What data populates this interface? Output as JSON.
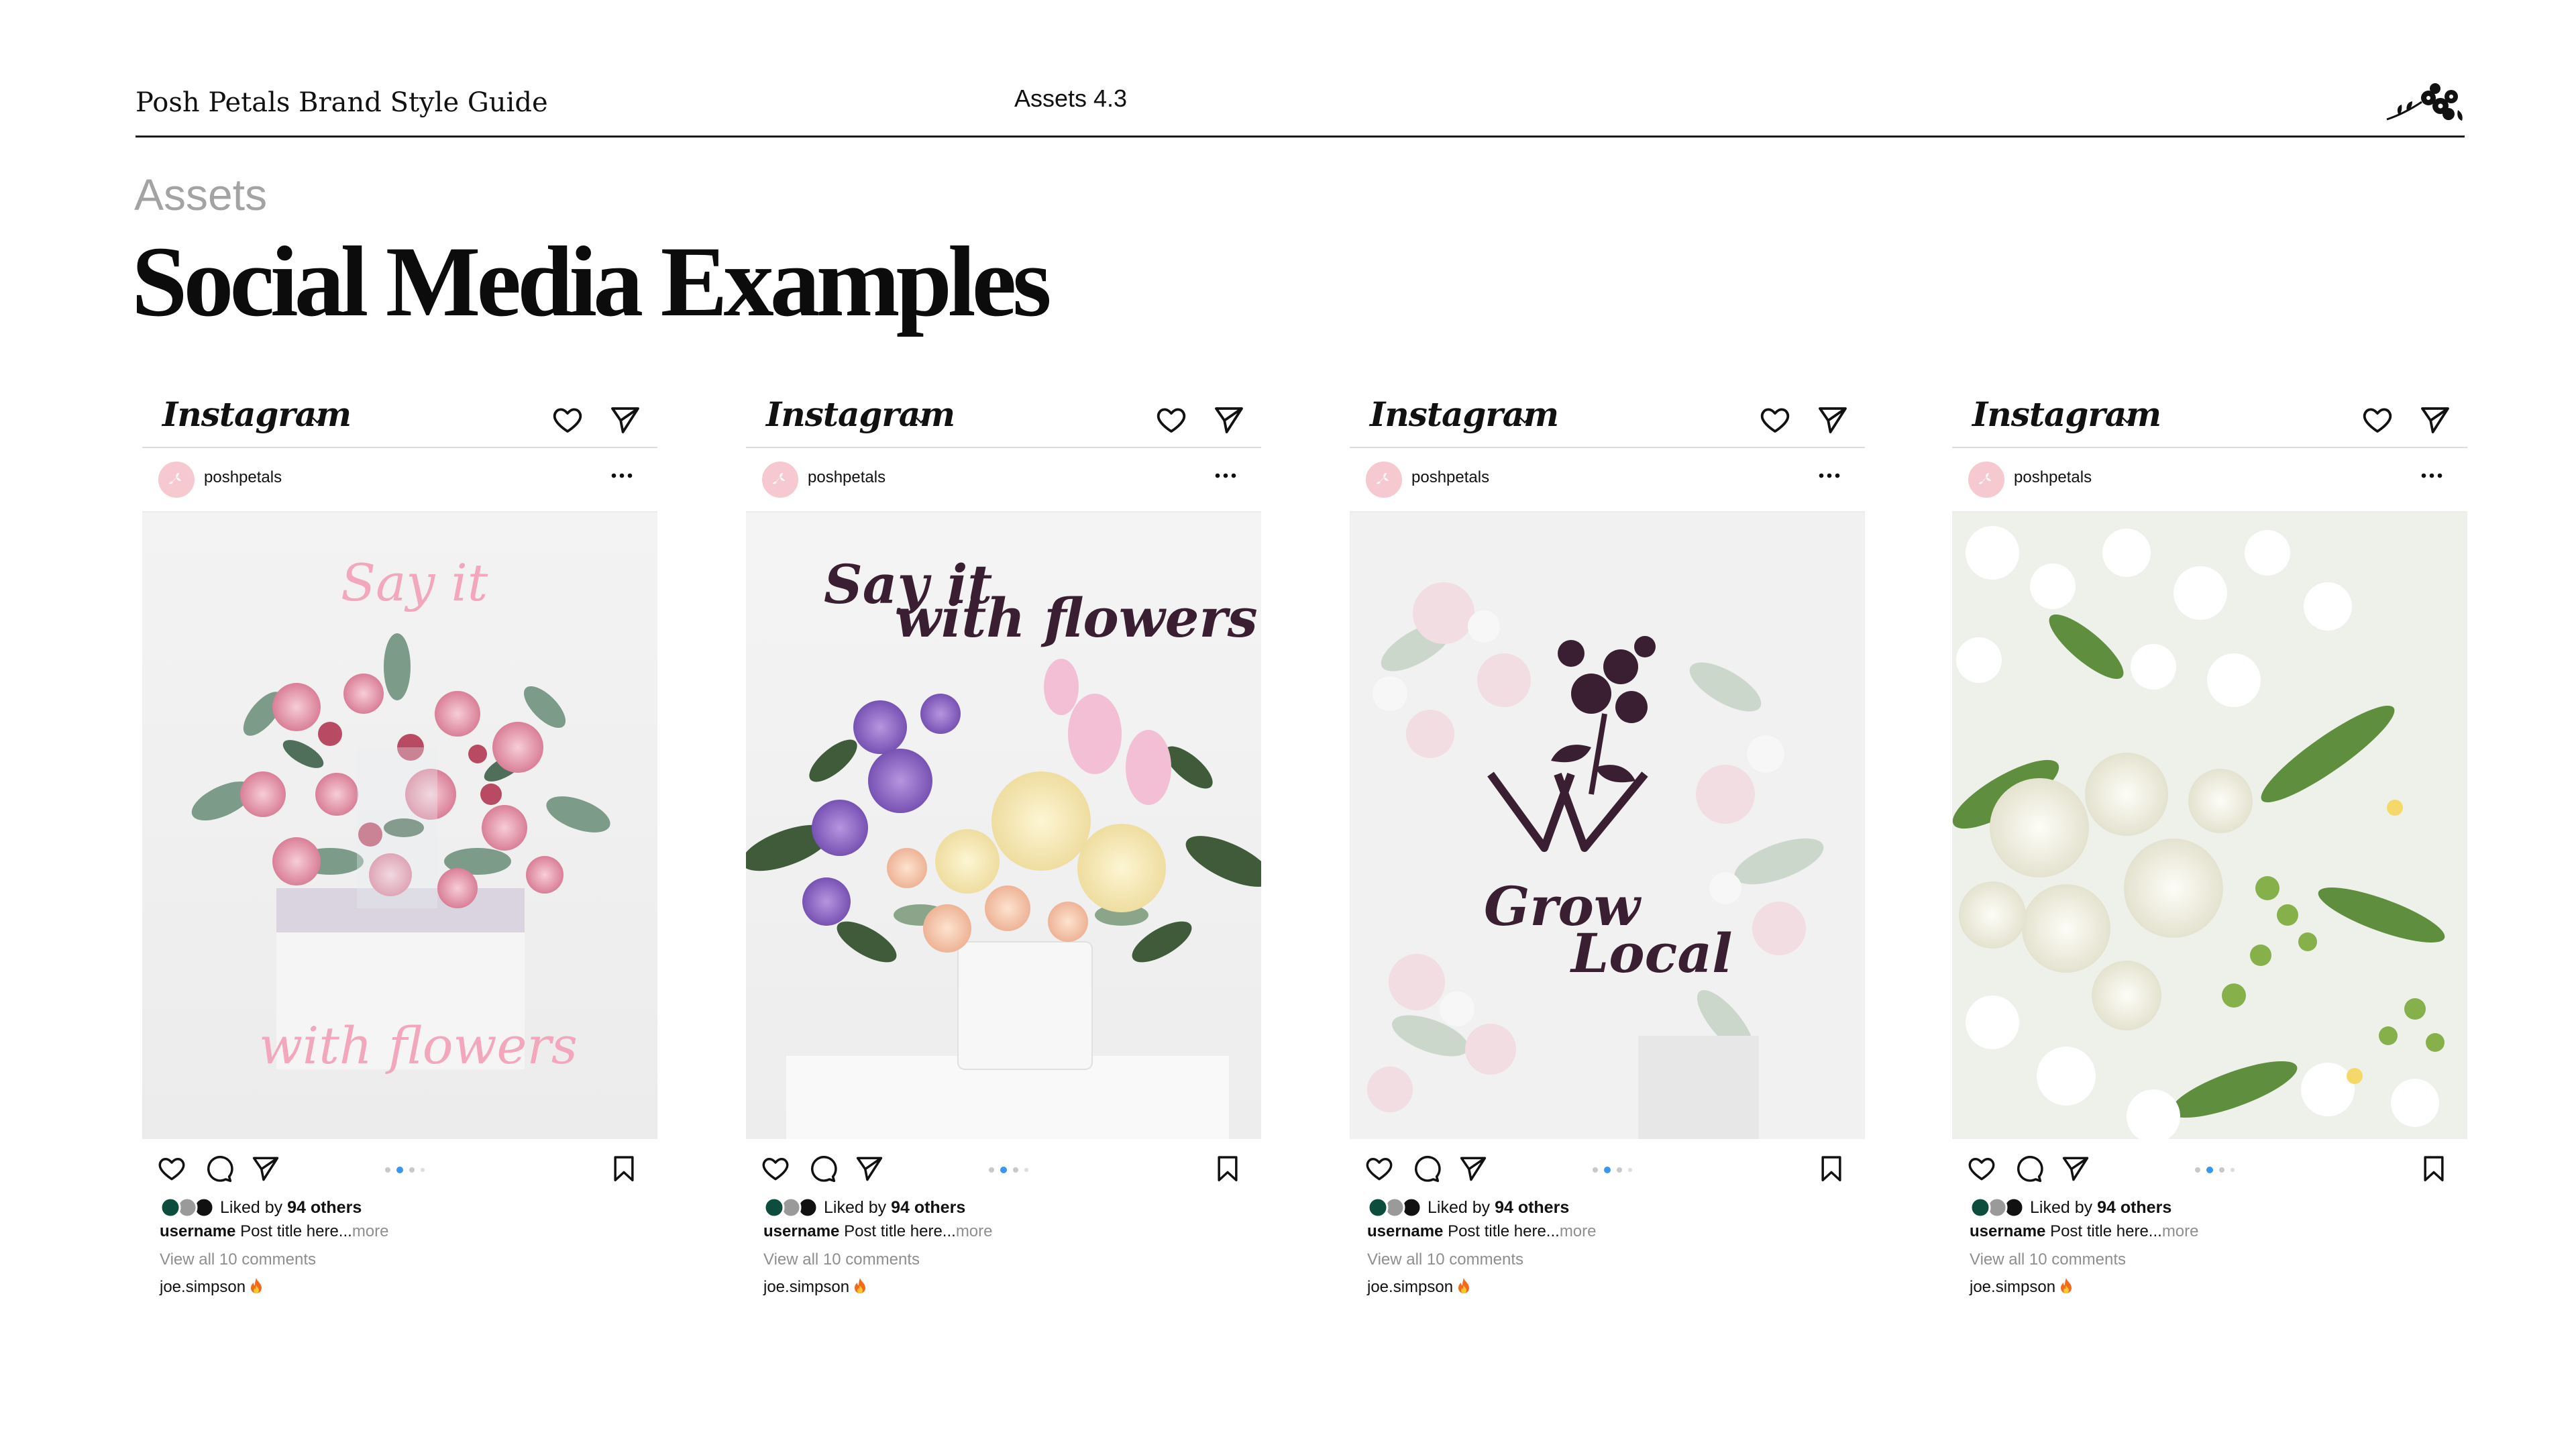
{
  "header": {
    "brand_title": "Posh Petals Brand Style Guide",
    "section_number": "Assets 4.3",
    "logo_icon": "floral-sprig-icon"
  },
  "page": {
    "eyebrow": "Assets",
    "title": "Social Media Examples"
  },
  "colors": {
    "brand_plum": "#3a1f33",
    "brand_pink": "#f3a7bd",
    "avatar_pink": "#f6c9d0",
    "muted_gray": "#8e8e8e",
    "active_dot": "#3897f0"
  },
  "posts": [
    {
      "platform": "Instagram",
      "username": "poshpetals",
      "overlay_line1": "Say it",
      "overlay_line2": "with flowers",
      "likes_prefix": "Liked by ",
      "likes_count": "94 others",
      "caption_user": "username",
      "caption_text": "Post title here...",
      "caption_more": "more",
      "comments": "View all 10 comments",
      "commenter": "joe.simpson",
      "active_slide": 2,
      "slides": 4
    },
    {
      "platform": "Instagram",
      "username": "poshpetals",
      "overlay_line1": "Say it",
      "overlay_line2": "with flowers",
      "likes_prefix": "Liked by ",
      "likes_count": "94 others",
      "caption_user": "username",
      "caption_text": "Post title here...",
      "caption_more": "more",
      "comments": "View all 10 comments",
      "commenter": "joe.simpson",
      "active_slide": 2,
      "slides": 4
    },
    {
      "platform": "Instagram",
      "username": "poshpetals",
      "overlay_line1": "Grow",
      "overlay_line2": "Local",
      "likes_prefix": "Liked by ",
      "likes_count": "94 others",
      "caption_user": "username",
      "caption_text": "Post title here...",
      "caption_more": "more",
      "comments": "View all 10 comments",
      "commenter": "joe.simpson",
      "active_slide": 2,
      "slides": 4
    },
    {
      "platform": "Instagram",
      "username": "poshpetals",
      "likes_prefix": "Liked by ",
      "likes_count": "94 others",
      "caption_user": "username",
      "caption_text": "Post title here...",
      "caption_more": "more",
      "comments": "View all 10 comments",
      "commenter": "joe.simpson",
      "active_slide": 2,
      "slides": 4
    }
  ]
}
